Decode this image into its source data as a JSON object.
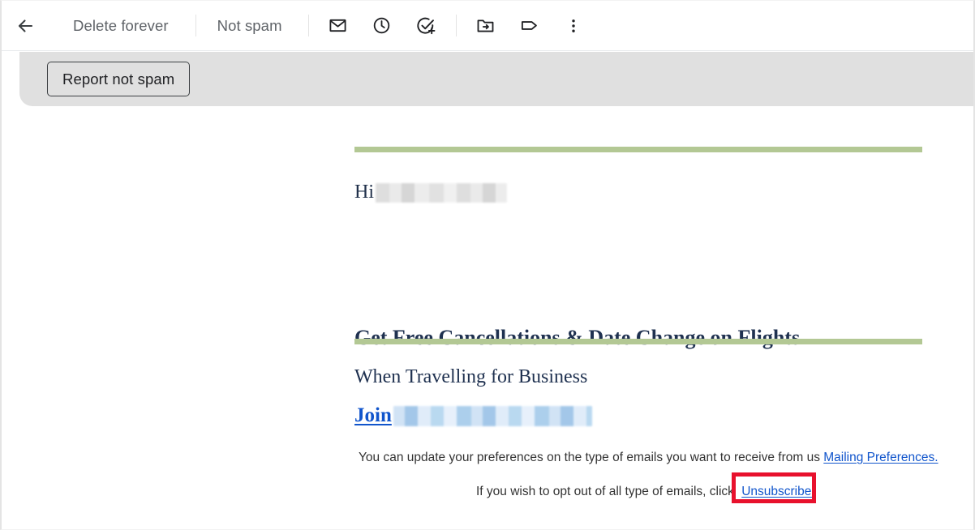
{
  "toolbar": {
    "back_icon": "arrow-back-icon",
    "delete_forever_label": "Delete forever",
    "not_spam_label": "Not spam",
    "icons": [
      {
        "name": "mark-as-unread-icon",
        "title": "Mark as unread"
      },
      {
        "name": "snooze-clock-icon",
        "title": "Snooze"
      },
      {
        "name": "add-to-tasks-icon",
        "title": "Add to tasks"
      },
      {
        "name": "move-to-folder-icon",
        "title": "Move to"
      },
      {
        "name": "labels-tag-icon",
        "title": "Labels"
      },
      {
        "name": "more-options-icon",
        "title": "More"
      }
    ]
  },
  "notice": {
    "report_not_spam_label": "Report not spam",
    "background_color": "#e0e0e0"
  },
  "email": {
    "divider_color": "#b3c894",
    "greeting_prefix": "Hi",
    "greeting_redacted": "",
    "headline": "Get Free Cancellations & Date Change on Flights",
    "subline": "When Travelling for Business",
    "join_label": "Join",
    "join_redacted": "",
    "text_color": "#1f3150",
    "link_color": "#1155cc"
  },
  "footer": {
    "line1_text": "You can update your preferences on the type of emails you want to receive from us ",
    "line1_link": "Mailing Preferences.",
    "line2_text": "If you wish to opt out of all type of emails, click ",
    "line2_link": "Unsubscribe.",
    "highlight_color": "#e8112d"
  }
}
